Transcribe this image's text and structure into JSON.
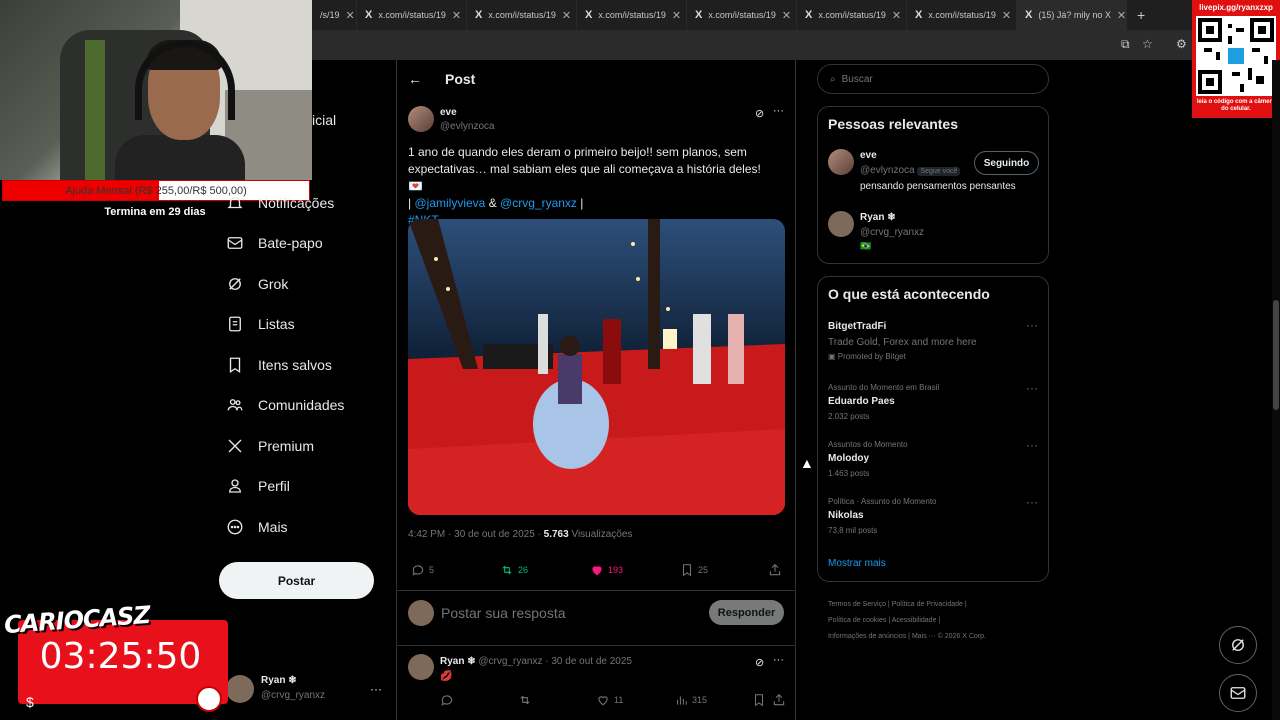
{
  "browser": {
    "tabs": [
      {
        "title": "/s/19"
      },
      {
        "title": "x.com/i/status/19"
      },
      {
        "title": "x.com/i/status/19"
      },
      {
        "title": "x.com/i/status/19"
      },
      {
        "title": "x.com/i/status/19"
      },
      {
        "title": "x.com/i/status/19"
      },
      {
        "title": "x.com/i/status/19"
      },
      {
        "title": "(15) Já? mily no X"
      }
    ],
    "new_tab": "+"
  },
  "stream": {
    "goal_text": "Ajuda Mensal (R$ 255,00/R$ 500,00)",
    "goal_progress": 0.51,
    "goal_sub": "Termina em 29 dias",
    "brand": "CARIOCASZ",
    "timer": "03:25:50",
    "livepix_url": "livepix.gg/ryanxzxp",
    "livepix_caption": "leia o código com a câmera do celular."
  },
  "nav": {
    "items": [
      {
        "label": "icial",
        "icon": "home-icon"
      },
      {
        "label": "Notificações",
        "icon": "bell-icon"
      },
      {
        "label": "Bate-papo",
        "icon": "mail-icon"
      },
      {
        "label": "Grok",
        "icon": "grok-icon"
      },
      {
        "label": "Listas",
        "icon": "list-icon"
      },
      {
        "label": "Itens salvos",
        "icon": "bookmark-icon"
      },
      {
        "label": "Comunidades",
        "icon": "people-icon"
      },
      {
        "label": "Premium",
        "icon": "x-logo-icon"
      },
      {
        "label": "Perfil",
        "icon": "person-icon"
      },
      {
        "label": "Mais",
        "icon": "more-circle-icon"
      }
    ],
    "post_button": "Postar",
    "account": {
      "name": "Ryan ❄",
      "handle": "@crvg_ryanxz",
      "more": "···"
    }
  },
  "post": {
    "header_title": "Post",
    "author_name": "eve",
    "author_handle": "@evlynzoca",
    "text_line1": "1 ano de quando eles deram o primeiro beijo!! sem planos, sem",
    "text_line2": "expectativas… mal sabiam eles que ali começava a história deles! 💌",
    "text_mention_prefix": "|",
    "mention1": "@jamilyvieva",
    "amp": "&",
    "mention2": "@crvg_ryanxz",
    "text_mention_suffix": "|",
    "hashtag": "#NKT",
    "timestamp": "4:42 PM · 30 de out de 2025 · ",
    "views": "5.763",
    "views_label": " Visualizações",
    "replies": "5",
    "reposts": "26",
    "likes": "193",
    "bookmarks": "25",
    "reply_placeholder": "Postar sua resposta",
    "reply_button": "Responder"
  },
  "reply_tweet": {
    "author_name": "Ryan ❄",
    "meta": "@crvg_ryanxz · 30 de out de 2025",
    "text": "💋",
    "reposts": "",
    "likes": "11",
    "views": "315"
  },
  "sidebar": {
    "search_placeholder": "Buscar",
    "relevant_title": "Pessoas relevantes",
    "people": [
      {
        "name": "eve",
        "handle": "@evlynzoca",
        "badge": "Segue você",
        "bio": "pensando pensamentos pensantes",
        "button": "Seguindo"
      },
      {
        "name": "Ryan ❄",
        "handle": "@crvg_ryanxz",
        "bio": "🇧🇷"
      }
    ],
    "trending_title": "O que está acontecendo",
    "trends": [
      {
        "context": "",
        "name": "BitgetTradFi",
        "desc": "Trade Gold, Forex and more here",
        "promo": "Promoted by Bitget",
        "posts": ""
      },
      {
        "context": "Assunto do Momento em Brasil",
        "name": "Eduardo Paes",
        "posts": "2.032 posts"
      },
      {
        "context": "Assuntos do Momento",
        "name": "Molodoy",
        "posts": "1.463 posts"
      },
      {
        "context": "Política · Assunto do Momento",
        "name": "Nikolas",
        "posts": "73,8 mil posts"
      }
    ],
    "show_more": "Mostrar mais",
    "footer": [
      "Termos de Serviço",
      "|",
      "Política de Privacidade",
      "|",
      "Política de cookies",
      "|",
      "Acessibilidade",
      "|",
      "Informações de anúncios",
      "|",
      "Mais ···",
      "© 2026 X Corp."
    ]
  }
}
